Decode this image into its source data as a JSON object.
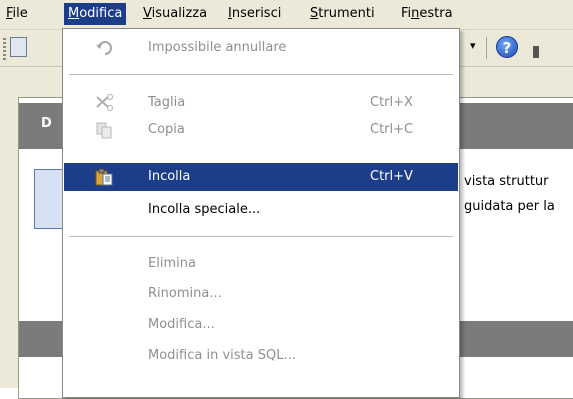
{
  "menubar": {
    "items": [
      {
        "label": "File",
        "underline": "F"
      },
      {
        "label": "Modifica",
        "underline": "M"
      },
      {
        "label": "Visualizza",
        "underline": "V"
      },
      {
        "label": "Inserisci",
        "underline": "I"
      },
      {
        "label": "Strumenti",
        "underline": "S"
      },
      {
        "label": "Finestra",
        "underline": "n"
      }
    ]
  },
  "toolbar": {
    "help_glyph": "?",
    "dropdown_arrow": "▾"
  },
  "content": {
    "section_label": "D",
    "text_line1": "vista struttur",
    "text_line2": "guidata per la"
  },
  "edit_menu": {
    "items": [
      {
        "label": "Impossibile annullare",
        "shortcut": "",
        "disabled": true,
        "icon": "undo-icon"
      },
      {
        "label": "Taglia",
        "shortcut": "Ctrl+X",
        "disabled": true,
        "icon": "scissors-icon"
      },
      {
        "label": "Copia",
        "shortcut": "Ctrl+C",
        "disabled": true,
        "icon": "copy-icon"
      },
      {
        "label": "Incolla",
        "shortcut": "Ctrl+V",
        "disabled": false,
        "selected": true,
        "icon": "paste-icon"
      },
      {
        "label": "Incolla speciale...",
        "shortcut": "",
        "disabled": false,
        "icon": ""
      },
      {
        "label": "Elimina",
        "shortcut": "",
        "disabled": true,
        "icon": ""
      },
      {
        "label": "Rinomina...",
        "shortcut": "",
        "disabled": true,
        "icon": ""
      },
      {
        "label": "Modifica...",
        "shortcut": "",
        "disabled": true,
        "icon": ""
      },
      {
        "label": "Modifica in vista SQL...",
        "shortcut": "",
        "disabled": true,
        "icon": ""
      }
    ]
  },
  "colors": {
    "selection": "#1c3d88",
    "menubar_bg": "#ece9d8",
    "disabled_text": "#8f8f8f"
  }
}
